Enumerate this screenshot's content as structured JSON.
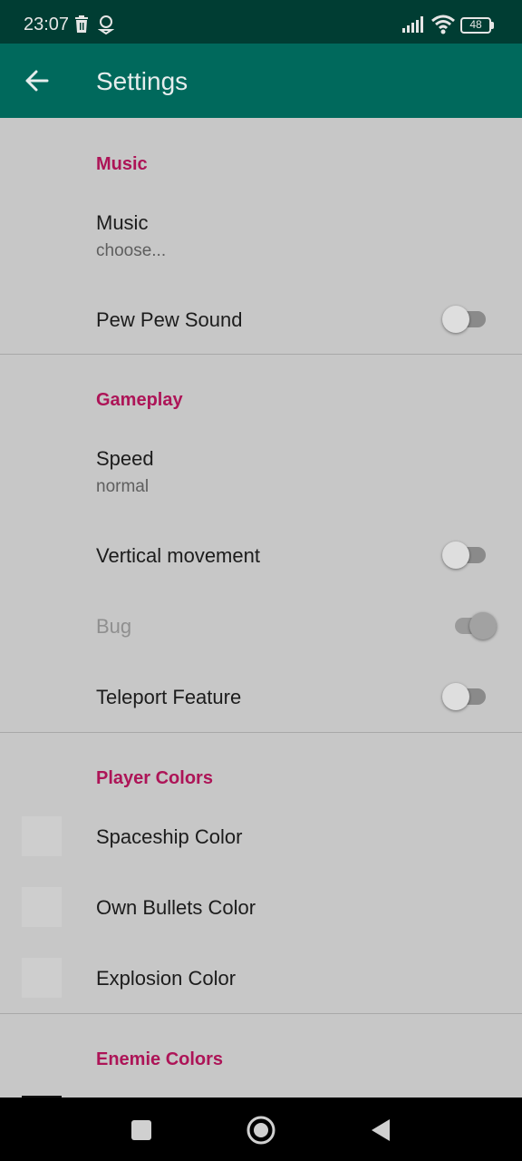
{
  "status_bar": {
    "time": "23:07",
    "battery": "48",
    "icons": [
      "trash-icon",
      "location-icon",
      "signal-icon",
      "wifi-icon",
      "battery-icon"
    ]
  },
  "app_bar": {
    "title": "Settings",
    "back_icon": "arrow-back-icon"
  },
  "sections": {
    "music": {
      "header": "Music",
      "music_title": "Music",
      "music_summary": "choose...",
      "pew_title": "Pew Pew Sound",
      "pew_on": false
    },
    "gameplay": {
      "header": "Gameplay",
      "speed_title": "Speed",
      "speed_summary": "normal",
      "vertical_title": "Vertical movement",
      "vertical_on": false,
      "bug_title": "Bug",
      "bug_on": true,
      "bug_enabled": false,
      "teleport_title": "Teleport Feature",
      "teleport_on": false
    },
    "player_colors": {
      "header": "Player Colors",
      "spaceship": "Spaceship Color",
      "bullets": "Own Bullets Color",
      "explosion": "Explosion Color"
    },
    "enemie_colors": {
      "header": "Enemie Colors"
    }
  },
  "colors": {
    "status_bar": "#003d33",
    "app_bar": "#00695c",
    "category_accent": "#ad1457",
    "background": "#c7c7c7"
  },
  "nav_bar": {
    "icons": [
      "recents-square-icon",
      "home-circle-icon",
      "back-triangle-icon"
    ]
  }
}
